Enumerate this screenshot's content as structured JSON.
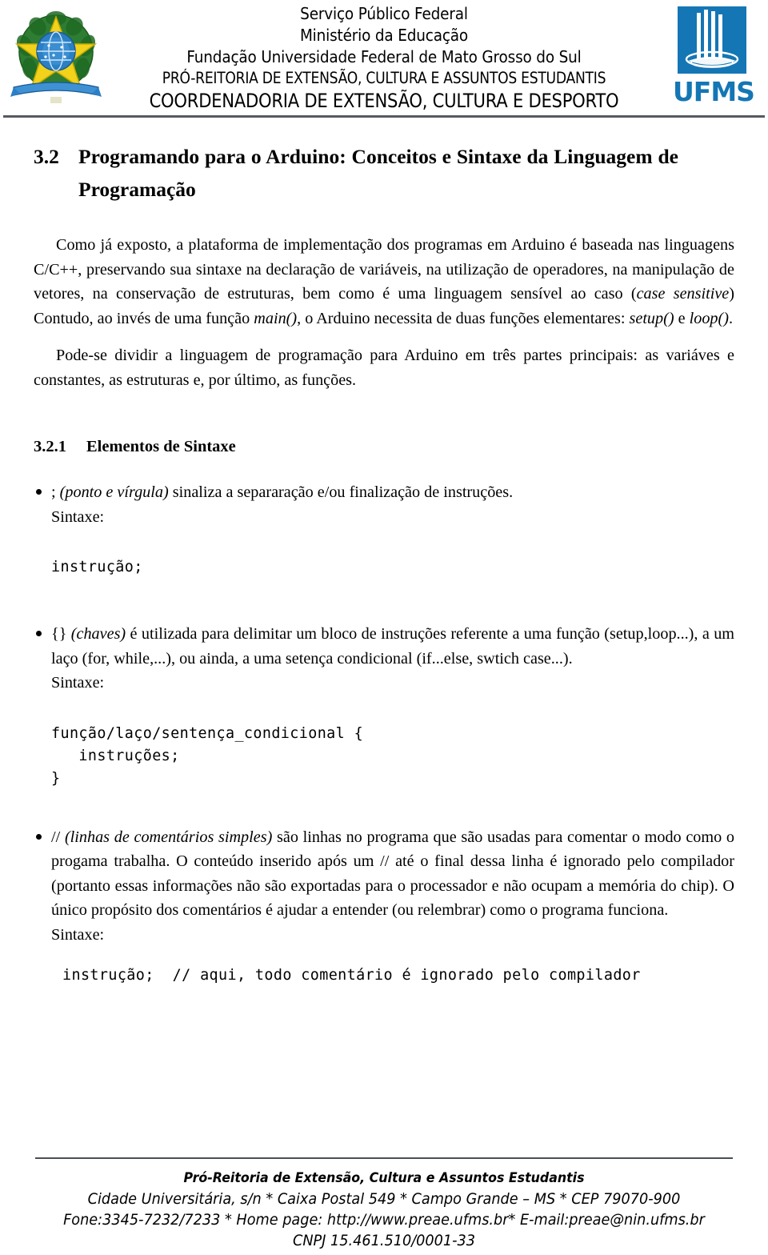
{
  "header": {
    "brasao_alt": "Brasão da República Federativa do Brasil",
    "lines": [
      "Serviço Público Federal",
      "Ministério da Educação",
      "Fundação Universidade Federal de Mato Grosso do Sul",
      "PRÓ-REITORIA DE EXTENSÃO, CULTURA E ASSUNTOS ESTUDANTIS",
      "COORDENADORIA DE EXTENSÃO, CULTURA E DESPORTO"
    ],
    "ufms_wordmark": "UFMS",
    "ufms_color": "#1476b5"
  },
  "section": {
    "number": "3.2",
    "title_line1": "Programando para o Arduino: Conceitos e Sintaxe da Linguagem de",
    "title_line2": "Programação"
  },
  "paragraphs": {
    "p1_a": "Como já exposto, a plataforma de implementação dos programas em Arduino é baseada nas linguagens C/C++, preservando sua sintaxe na declaração de variáveis, na utilização de operadores, na manipulação de vetores, na conservação de estruturas, bem como é uma linguagem sensível ao caso (",
    "p1_it1": "case sensitive",
    "p1_b": ") Contudo, ao invés de uma função ",
    "p1_it2": "main()",
    "p1_c": ", o Arduino necessita de duas funções elementares: ",
    "p1_it3": "setup()",
    "p1_d": " e ",
    "p1_it4": "loop()",
    "p1_e": ".",
    "p2": "Pode-se dividir a linguagem de programação para Arduino em três partes principais: as variáves e constantes, as estruturas e, por último, as funções."
  },
  "subsection": {
    "number": "3.2.1",
    "title": "Elementos de Sintaxe"
  },
  "bullets": [
    {
      "lead": "; ",
      "italic": "(ponto e vírgula)",
      "rest": " sinaliza a separaração e/ou finalização de instruções.",
      "sintaxe_label": "Sintaxe:",
      "code": "instrução;"
    },
    {
      "lead": "{}   ",
      "italic": "(chaves)",
      "rest": " é utilizada para delimitar um bloco de instruções referente a uma função (setup,loop...), a um laço (for, while,...), ou ainda, a uma setença condicional (if...else, swtich case...).",
      "sintaxe_label": "Sintaxe:",
      "code": "função/laço/sentença_condicional {\n   instruções;\n}"
    },
    {
      "lead": "// ",
      "italic": "(linhas de comentários simples)",
      "rest": " são linhas no programa que são usadas para comentar o modo como o progama trabalha. O conteúdo inserido após um // até o final dessa linha é ignorado pelo compilador (portanto essas informações não são exportadas para o processador e não ocupam a memória do chip). O único propósito dos comentários é ajudar a entender (ou relembrar) como o programa funciona.",
      "sintaxe_label": "Sintaxe:",
      "code": "instrução;  // aqui, todo comentário é ignorado pelo compilador"
    }
  ],
  "footer": {
    "line1": "Pró-Reitoria de Extensão, Cultura e Assuntos Estudantis",
    "line2": "Cidade Universitária, s/n * Caixa Postal 549 * Campo Grande – MS * CEP 79070-900",
    "line3": "Fone:3345-7232/7233 * Home page: http://www.preae.ufms.br* E-mail:preae@nin.ufms.br",
    "line4": "CNPJ 15.461.510/0001-33"
  }
}
